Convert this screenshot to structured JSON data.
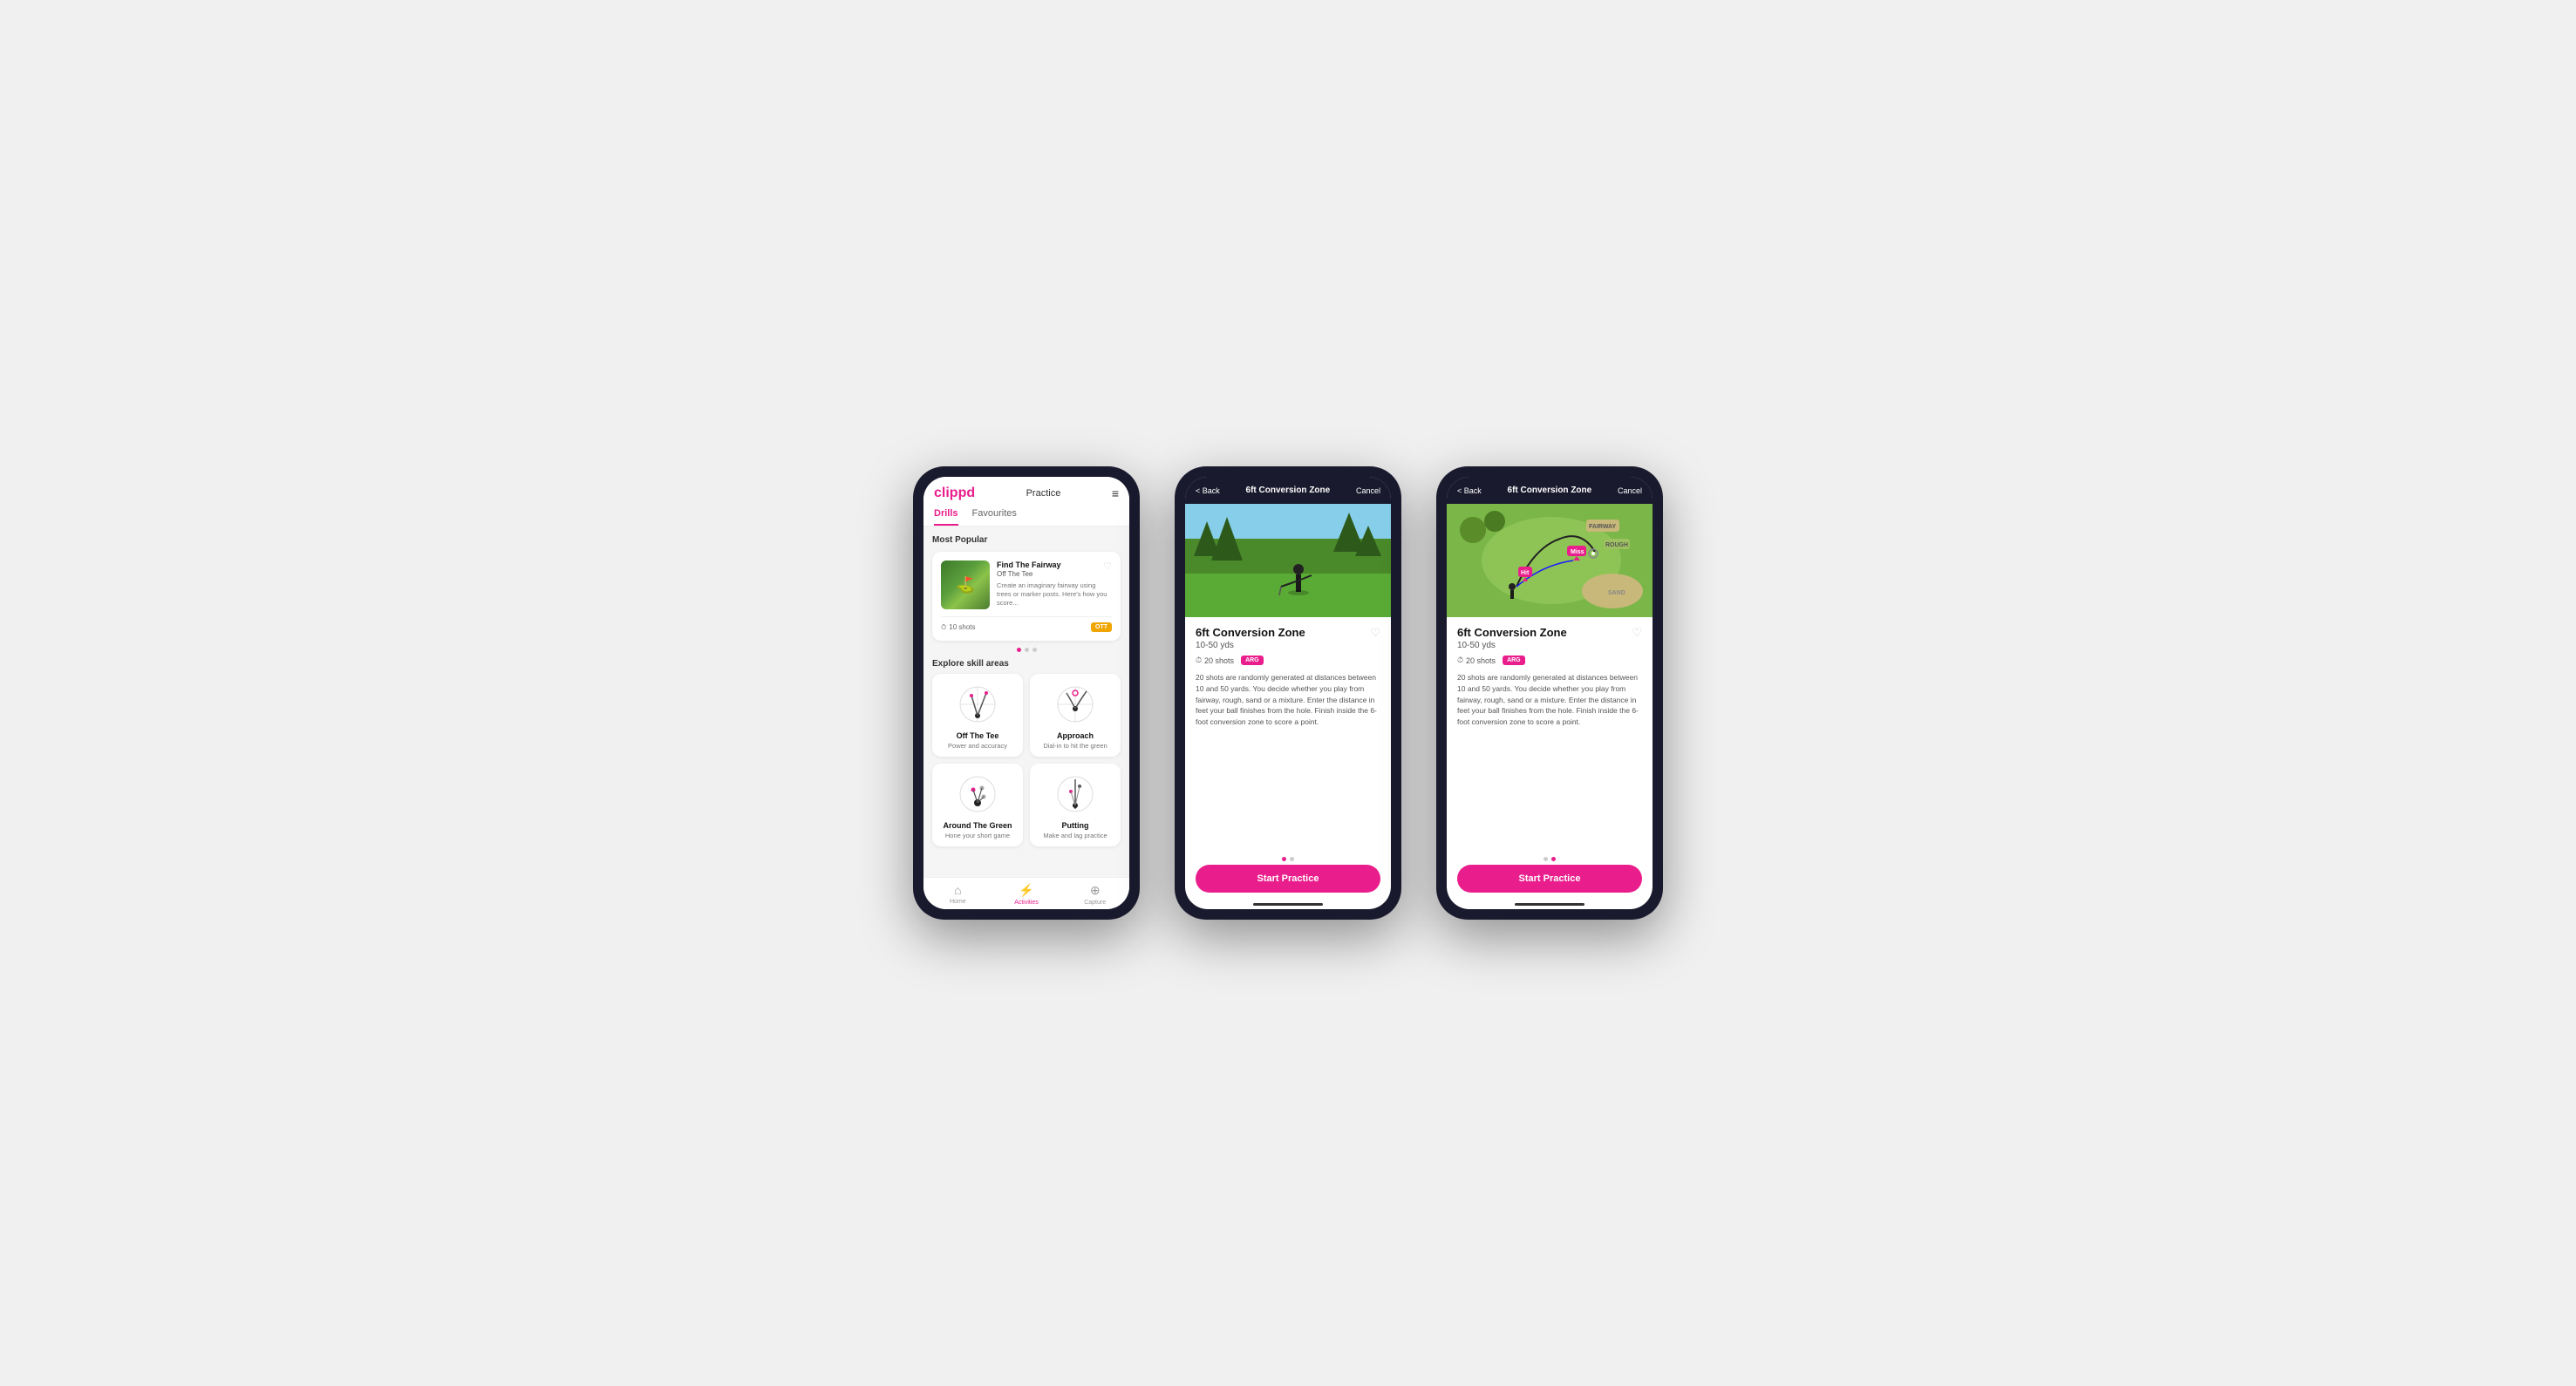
{
  "phone1": {
    "logo": "clippd",
    "nav_title": "Practice",
    "menu_icon": "≡",
    "tabs": [
      {
        "label": "Drills",
        "active": true
      },
      {
        "label": "Favourites",
        "active": false
      }
    ],
    "most_popular_label": "Most Popular",
    "featured_drill": {
      "name": "Find The Fairway",
      "subtitle": "Off The Tee",
      "description": "Create an imaginary fairway using trees or marker posts. Here's how you score...",
      "shots": "10 shots",
      "badge": "OTT",
      "fav_icon": "♡"
    },
    "explore_label": "Explore skill areas",
    "skill_areas": [
      {
        "name": "Off The Tee",
        "desc": "Power and accuracy"
      },
      {
        "name": "Approach",
        "desc": "Dial-in to hit the green"
      },
      {
        "name": "Around The Green",
        "desc": "Hone your short game"
      },
      {
        "name": "Putting",
        "desc": "Make and lag practice"
      }
    ],
    "bottom_nav": [
      {
        "label": "Home",
        "icon": "⌂",
        "active": false
      },
      {
        "label": "Activities",
        "icon": "⚡",
        "active": true
      },
      {
        "label": "Capture",
        "icon": "⊕",
        "active": false
      }
    ]
  },
  "phone2": {
    "back_label": "< Back",
    "title": "6ft Conversion Zone",
    "cancel_label": "Cancel",
    "drill_name": "6ft Conversion Zone",
    "drill_yds": "10-50 yds",
    "shots": "20 shots",
    "badge": "ARG",
    "description": "20 shots are randomly generated at distances between 10 and 50 yards. You decide whether you play from fairway, rough, sand or a mixture. Enter the distance in feet your ball finishes from the hole. Finish inside the 6-foot conversion zone to score a point.",
    "start_btn": "Start Practice",
    "fav_icon": "♡",
    "dots": [
      {
        "active": true
      },
      {
        "active": false
      }
    ]
  },
  "phone3": {
    "back_label": "< Back",
    "title": "6ft Conversion Zone",
    "cancel_label": "Cancel",
    "drill_name": "6ft Conversion Zone",
    "drill_yds": "10-50 yds",
    "shots": "20 shots",
    "badge": "ARG",
    "description": "20 shots are randomly generated at distances between 10 and 50 yards. You decide whether you play from fairway, rough, sand or a mixture. Enter the distance in feet your ball finishes from the hole. Finish inside the 6-foot conversion zone to score a point.",
    "start_btn": "Start Practice",
    "fav_icon": "♡",
    "dots": [
      {
        "active": false
      },
      {
        "active": true
      }
    ]
  }
}
